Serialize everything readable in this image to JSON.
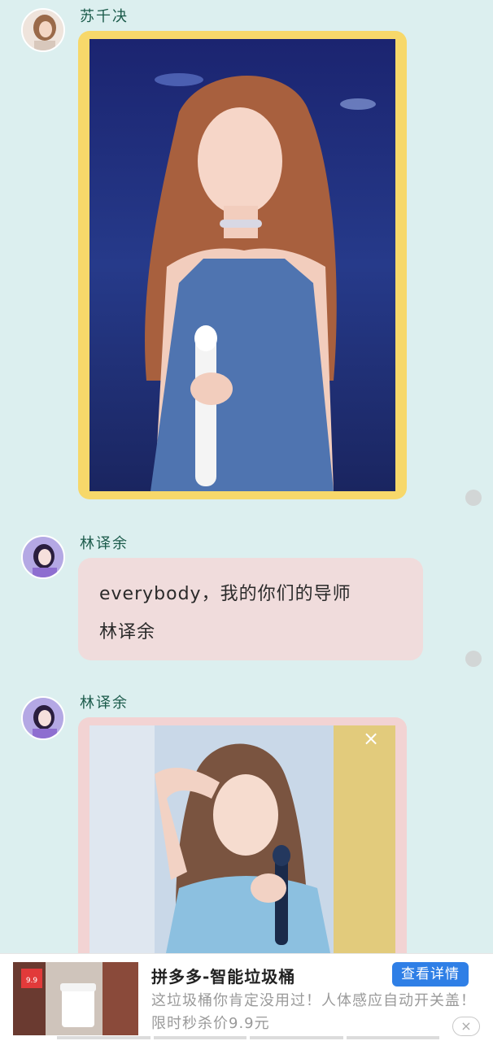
{
  "messages": [
    {
      "sender": "苏千决",
      "type": "image",
      "frame_color": "#f7d86a",
      "photo": "woman with microphone in denim dress"
    },
    {
      "sender": "林译余",
      "type": "text",
      "lines": [
        "everybody，我的你们的导师",
        "林译余"
      ]
    },
    {
      "sender": "林译余",
      "type": "image",
      "frame_color": "#f2d3d3",
      "photo": "woman in light blue shirt holding microphone"
    }
  ],
  "colors": {
    "background": "#dcefef",
    "name_text": "#1a5a4a",
    "text_bubble": "#f0dcdc",
    "ad_cta": "#2f7fe6"
  },
  "ad": {
    "title": "拼多多-智能垃圾桶",
    "cta_label": "查看详情",
    "description": "这垃圾桶你肯定没用过！人体感应自动开关盖！限时秒杀价9.9元",
    "thumb_price_badge": "9.9",
    "close_icon": "close-icon"
  },
  "icons": {
    "image_close": "×",
    "ad_close": "×"
  }
}
